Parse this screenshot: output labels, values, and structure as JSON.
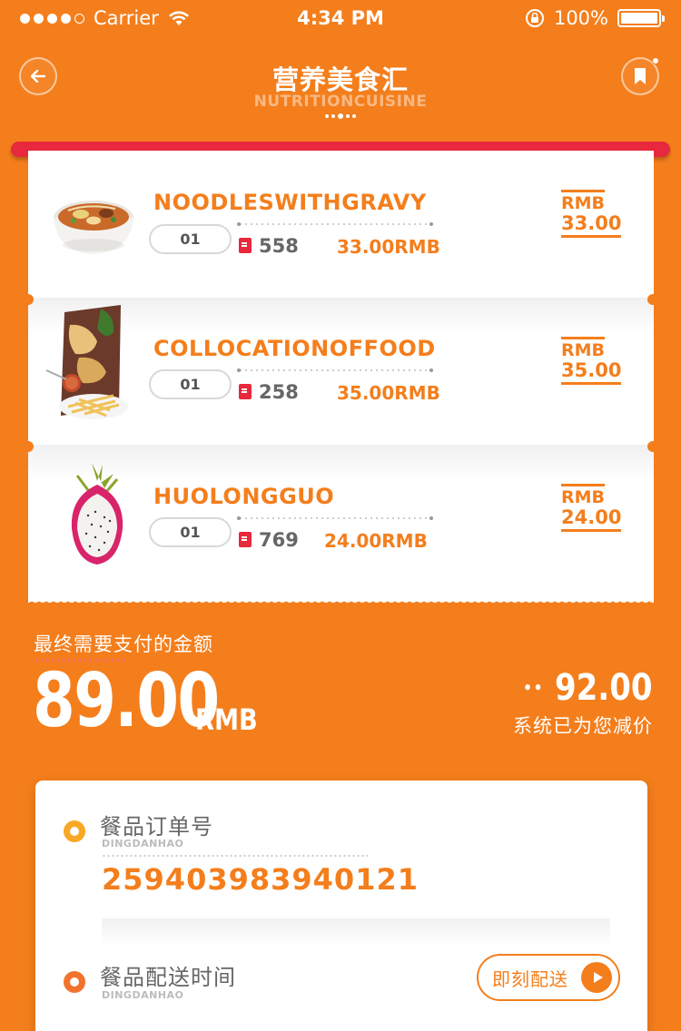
{
  "status_bar": {
    "carrier": "Carrier",
    "time": "4:34 PM",
    "battery": "100%"
  },
  "header": {
    "title": "营养美食汇",
    "subtitle": "NUTRITIONCUISINE"
  },
  "items": [
    {
      "name": "NOODLESWITHGRAVY",
      "qty": "01",
      "count": "558",
      "line_price": "33.00RMB",
      "currency": "RMB",
      "amount": "33.00"
    },
    {
      "name": "COLLOCATIONOFFOOD",
      "qty": "01",
      "count": "258",
      "line_price": "35.00RMB",
      "currency": "RMB",
      "amount": "35.00"
    },
    {
      "name": "HUOLONGGUO",
      "qty": "01",
      "count": "769",
      "line_price": "24.00RMB",
      "currency": "RMB",
      "amount": "24.00"
    }
  ],
  "total": {
    "label": "最终需要支付的金额",
    "amount": "89.00",
    "currency": "RMB",
    "original_price": "92.00",
    "discount_text": "系统已为您减价"
  },
  "order": {
    "number_title": "餐品订单号",
    "number_sub": "DINGDANHAO",
    "number": "259403983940121",
    "delivery_title": "餐品配送时间",
    "delivery_sub": "DINGDANHAO",
    "delivery_button": "即刻配送"
  },
  "colors": {
    "brand": "#F47E1C",
    "accent_red": "#E8283C",
    "bullet_yellow": "#F9A826"
  }
}
